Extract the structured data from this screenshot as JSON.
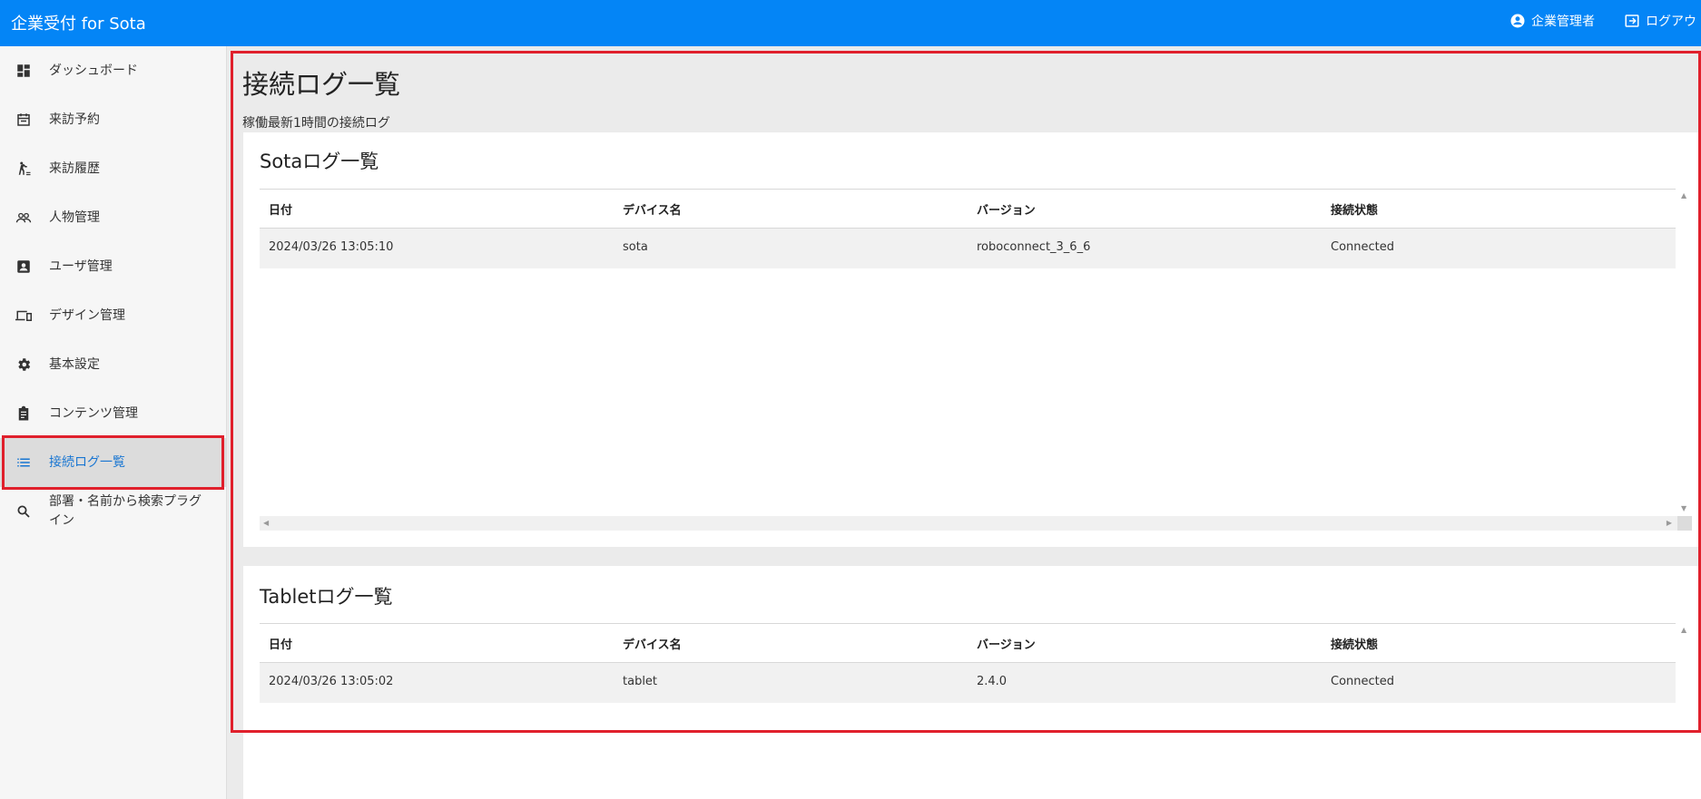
{
  "header": {
    "app_title": "企業受付 for Sota",
    "user_label": "企業管理者",
    "logout_label": "ログアウ",
    "bg_color": "#0485f6"
  },
  "sidebar": {
    "items": [
      {
        "label": "ダッシュボード",
        "icon": "dashboard-icon"
      },
      {
        "label": "来訪予約",
        "icon": "calendar-icon"
      },
      {
        "label": "来訪履歴",
        "icon": "walk-icon"
      },
      {
        "label": "人物管理",
        "icon": "people-icon"
      },
      {
        "label": "ユーザ管理",
        "icon": "contact-card-icon"
      },
      {
        "label": "デザイン管理",
        "icon": "devices-icon"
      },
      {
        "label": "基本設定",
        "icon": "gear-icon"
      },
      {
        "label": "コンテンツ管理",
        "icon": "clipboard-icon"
      },
      {
        "label": "接続ログ一覧",
        "icon": "list-icon",
        "active": true
      },
      {
        "label": "部署・名前から検索プラグイン",
        "icon": "search-icon"
      }
    ],
    "active_color": "#1976d2"
  },
  "main": {
    "title": "接続ログ一覧",
    "subtitle": "稼働最新1時間の接続ログ",
    "sota": {
      "title": "Sotaログ一覧",
      "headers": [
        "日付",
        "デバイス名",
        "バージョン",
        "接続状態"
      ],
      "rows": [
        [
          "2024/03/26 13:05:10",
          "sota",
          "roboconnect_3_6_6",
          "Connected"
        ]
      ]
    },
    "tablet": {
      "title": "Tabletログ一覧",
      "headers": [
        "日付",
        "デバイス名",
        "バージョン",
        "接続状態"
      ],
      "rows": [
        [
          "2024/03/26 13:05:02",
          "tablet",
          "2.4.0",
          "Connected"
        ]
      ]
    }
  },
  "highlight_color": "#e0202c"
}
